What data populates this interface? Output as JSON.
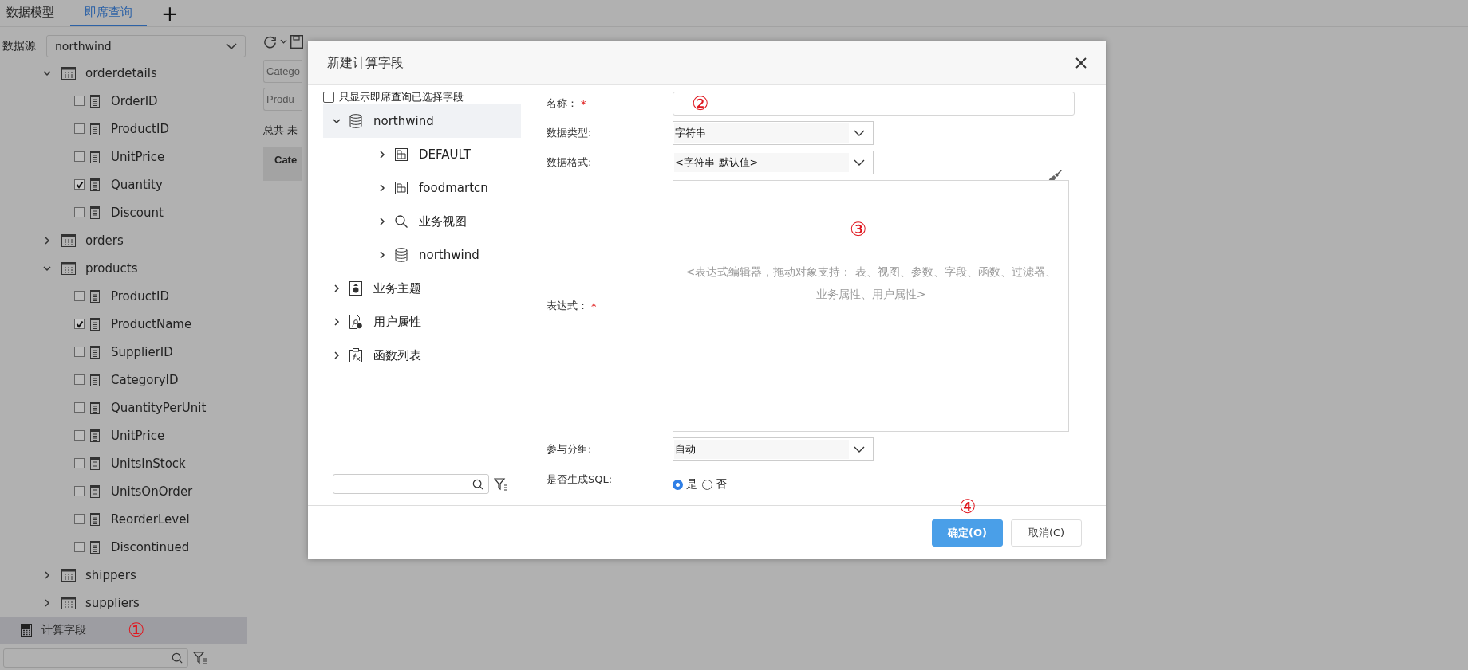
{
  "top_tabs": [
    {
      "label": "数据模型",
      "selected": false
    },
    {
      "label": "即席查询",
      "selected": true
    }
  ],
  "add_tab": "+",
  "datasource": {
    "label": "数据源",
    "value": "northwind"
  },
  "tree": [
    {
      "label": "orderdetails",
      "expanded": true,
      "children": [
        {
          "label": "OrderID",
          "checked": false
        },
        {
          "label": "ProductID",
          "checked": false
        },
        {
          "label": "UnitPrice",
          "checked": false
        },
        {
          "label": "Quantity",
          "checked": true
        },
        {
          "label": "Discount",
          "checked": false
        }
      ]
    },
    {
      "label": "orders",
      "expanded": false
    },
    {
      "label": "products",
      "expanded": true,
      "children": [
        {
          "label": "ProductID",
          "checked": false
        },
        {
          "label": "ProductName",
          "checked": true
        },
        {
          "label": "SupplierID",
          "checked": false
        },
        {
          "label": "CategoryID",
          "checked": false
        },
        {
          "label": "QuantityPerUnit",
          "checked": false
        },
        {
          "label": "UnitPrice",
          "checked": false
        },
        {
          "label": "UnitsInStock",
          "checked": false
        },
        {
          "label": "UnitsOnOrder",
          "checked": false
        },
        {
          "label": "ReorderLevel",
          "checked": false
        },
        {
          "label": "Discontinued",
          "checked": false
        }
      ]
    },
    {
      "label": "shippers",
      "expanded": false
    },
    {
      "label": "suppliers",
      "expanded": false
    }
  ],
  "calc_field": {
    "label": "计算字段",
    "selected": true,
    "marker": "①"
  },
  "query": {
    "fields": [
      "Catego",
      "Produ"
    ],
    "summary": "总共 未",
    "column_header": "Cate"
  },
  "dialog": {
    "title": "新建计算字段",
    "filter_checkbox": {
      "label": "只显示即席查询已选择字段",
      "checked": false
    },
    "tree": [
      {
        "label": "northwind",
        "kind": "database",
        "expanded": true,
        "selected": true,
        "children": [
          {
            "label": "DEFAULT",
            "kind": "schema",
            "expanded": false,
            "selected": false
          },
          {
            "label": "foodmartcn",
            "kind": "schema",
            "expanded": false,
            "selected": false
          },
          {
            "label": "业务视图",
            "kind": "view",
            "expanded": false,
            "selected": false
          },
          {
            "label": "northwind",
            "kind": "database",
            "expanded": false,
            "selected": false
          }
        ]
      },
      {
        "label": "业务主题",
        "kind": "theme",
        "expanded": false,
        "selected": false
      },
      {
        "label": "用户属性",
        "kind": "user",
        "expanded": false,
        "selected": false
      },
      {
        "label": "函数列表",
        "kind": "function",
        "expanded": false,
        "selected": false
      }
    ],
    "form": [
      {
        "kind": "text",
        "label": "名称：",
        "required_mark": "*",
        "marker": "②"
      },
      {
        "kind": "select",
        "label": "数据类型:",
        "value": "字符串"
      },
      {
        "kind": "select",
        "label": "数据格式:",
        "value": "<字符串-默认值>",
        "brush": true
      },
      {
        "kind": "expression",
        "label": "表达式：",
        "required_mark": "*",
        "placeholder": "<表达式编辑器，拖动对象支持： 表、视图、参数、字段、函数、过滤器、业务属性、用户属性>",
        "marker": "③"
      },
      {
        "kind": "select",
        "label": "参与分组:",
        "value": "自动"
      },
      {
        "kind": "radio",
        "label": "是否生成SQL:",
        "options": [
          {
            "label": "是",
            "selected": true
          },
          {
            "label": "否",
            "selected": false
          }
        ]
      }
    ],
    "buttons": [
      {
        "label": "确定(O)",
        "primary": true,
        "marker": "④"
      },
      {
        "label": "取消(C)",
        "primary": false
      }
    ]
  }
}
